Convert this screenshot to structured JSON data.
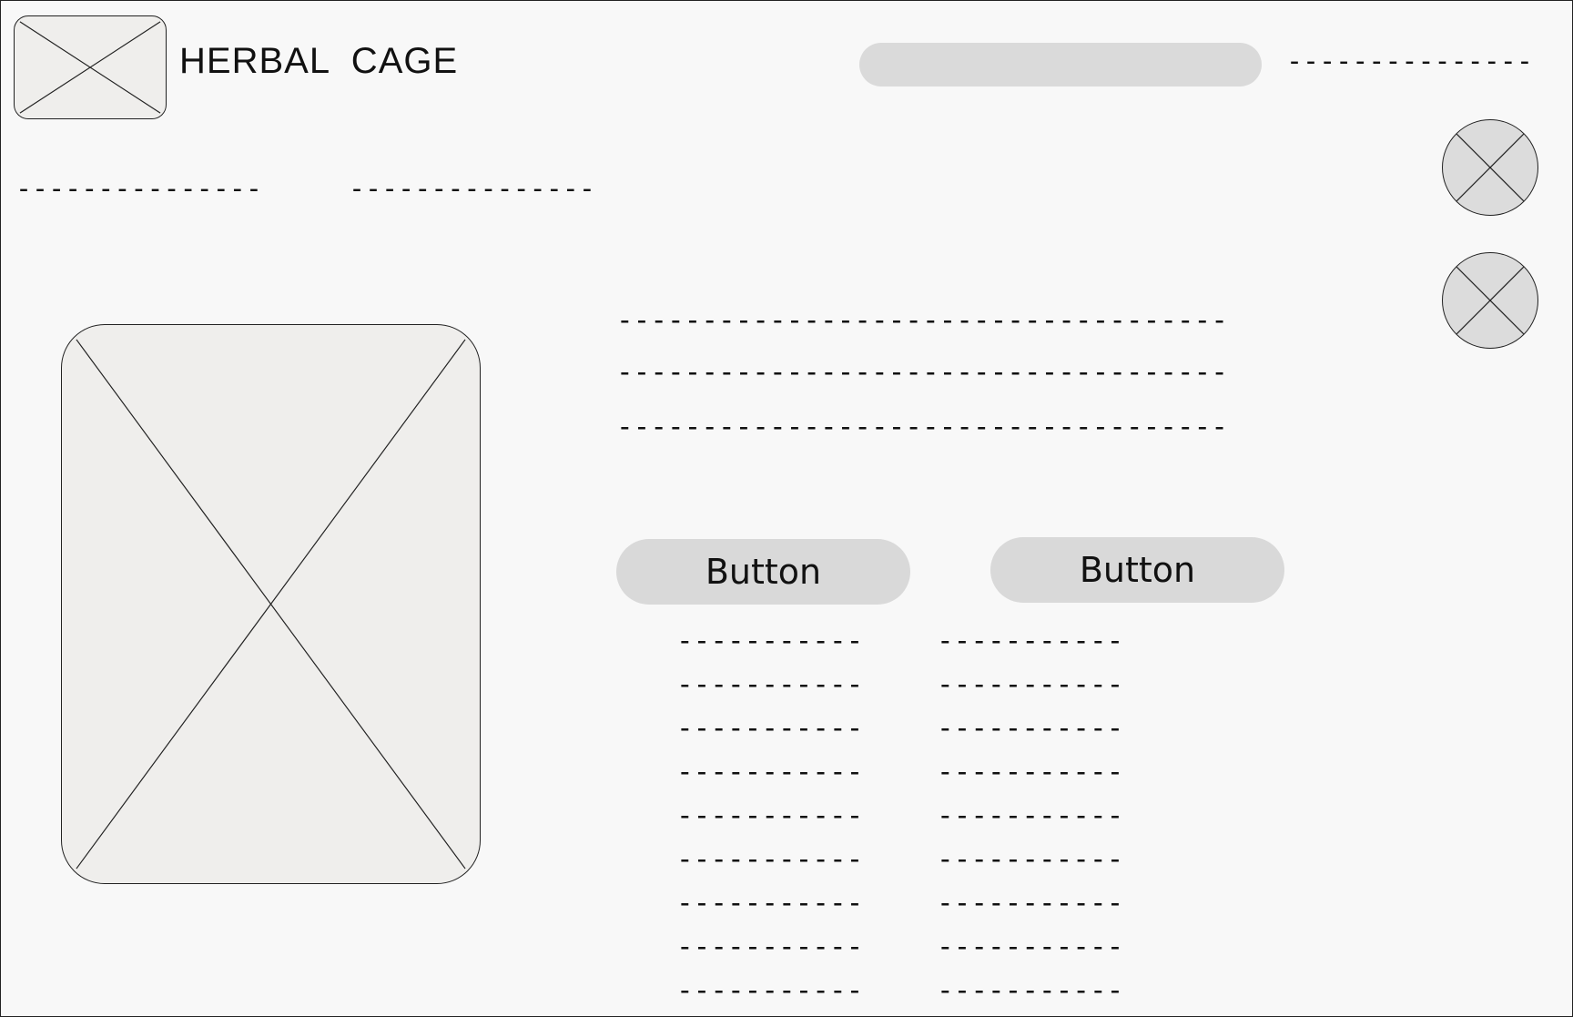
{
  "header": {
    "title": "HERBAL  CAGE",
    "logo_icon": "image-placeholder-icon",
    "search_placeholder": "",
    "top_right_link": "---------------"
  },
  "nav": {
    "items": [
      "---------------",
      "---------------"
    ]
  },
  "side_icons": [
    "image-placeholder-icon",
    "image-placeholder-icon"
  ],
  "product": {
    "image_icon": "image-placeholder-icon",
    "description_lines": [
      "------------------------------------",
      "------------------------------------",
      "------------------------------------"
    ]
  },
  "actions": {
    "button_1_label": "Button",
    "button_2_label": "Button"
  },
  "details": {
    "left_column": [
      "-----------",
      "-----------",
      "-----------",
      "-----------",
      "-----------",
      "-----------",
      "-----------",
      "-----------",
      "-----------"
    ],
    "right_column": [
      "-----------",
      "-----------",
      "-----------",
      "-----------",
      "-----------",
      "-----------",
      "-----------",
      "-----------",
      "-----------"
    ]
  },
  "colors": {
    "background": "#f8f8f8",
    "placeholder_fill": "#efeeec",
    "control_fill": "#d9d9d9",
    "stroke": "#222222"
  }
}
